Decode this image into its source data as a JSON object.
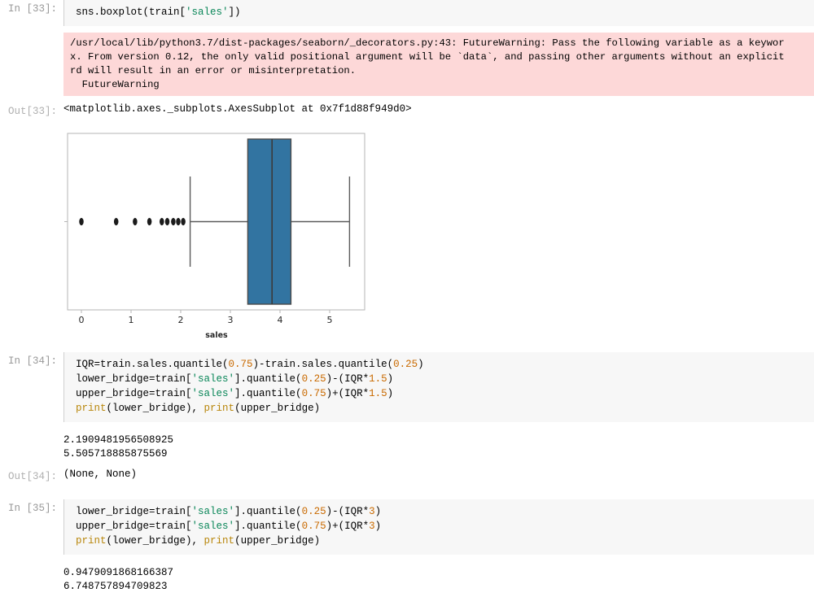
{
  "notebook": {
    "cells": [
      {
        "kind": "code",
        "prompt": "In [33]:",
        "source": "sns.boxplot(train['sales'])"
      },
      {
        "kind": "stderr",
        "text": "/usr/local/lib/python3.7/dist-packages/seaborn/_decorators.py:43: FutureWarning: Pass the following variable as a keyword\nx. From version 0.12, the only valid positional argument will be `data`, and passing other arguments without an explicit\nrd will result in an error or misinterpretation.\n  FutureWarning"
      },
      {
        "kind": "result",
        "prompt": "Out[33]:",
        "text": "<matplotlib.axes._subplots.AxesSubplot at 0x7f1d88f949d0>"
      },
      {
        "kind": "figure",
        "prompt": ""
      },
      {
        "kind": "code",
        "prompt": "In [34]:",
        "source": "IQR=train.sales.quantile(0.75)-train.sales.quantile(0.25)\nlower_bridge=train['sales'].quantile(0.25)-(IQR*1.5)\nupper_bridge=train['sales'].quantile(0.75)+(IQR*1.5)\nprint(lower_bridge), print(upper_bridge)"
      },
      {
        "kind": "stdout",
        "text": "2.1909481956508925\n5.505718885875569"
      },
      {
        "kind": "result",
        "prompt": "Out[34]:",
        "text": "(None, None)"
      },
      {
        "kind": "code",
        "prompt": "In [35]:",
        "source": "lower_bridge=train['sales'].quantile(0.25)-(IQR*3)\nupper_bridge=train['sales'].quantile(0.75)+(IQR*3)\nprint(lower_bridge), print(upper_bridge)"
      },
      {
        "kind": "stdout2",
        "text": "0.9479091868166387\n6.748757894709823"
      }
    ]
  },
  "cell33": {
    "prompt": "In [33]:",
    "code_pre": "sns.boxplot(train[",
    "code_str": "'sales'",
    "code_post": "])"
  },
  "warning": {
    "line1": "/usr/local/lib/python3.7/dist-packages/seaborn/_decorators.py:43: FutureWarning: Pass the following variable as a keywor",
    "line2": "x. From version 0.12, the only valid positional argument will be `data`, and passing other arguments without an explicit",
    "line3": "rd will result in an error or misinterpretation.",
    "line4": "  FutureWarning"
  },
  "out33": {
    "prompt": "Out[33]:",
    "text": "<matplotlib.axes._subplots.AxesSubplot at 0x7f1d88f949d0>"
  },
  "cell34": {
    "prompt": "In [34]:",
    "l1a": "IQR=train.sales.quantile(",
    "l1b": "0.75",
    "l1c": ")-train.sales.quantile(",
    "l1d": "0.25",
    "l1e": ")",
    "l2a": "lower_bridge=train[",
    "l2b": "'sales'",
    "l2c": "].quantile(",
    "l2d": "0.25",
    "l2e": ")-(IQR*",
    "l2f": "1.5",
    "l2g": ")",
    "l3a": "upper_bridge=train[",
    "l3b": "'sales'",
    "l3c": "].quantile(",
    "l3d": "0.75",
    "l3e": ")+(IQR*",
    "l3f": "1.5",
    "l3g": ")",
    "l4a": "print",
    "l4b": "(lower_bridge), ",
    "l4c": "print",
    "l4d": "(upper_bridge)"
  },
  "stdout34": {
    "line1": "2.1909481956508925",
    "line2": "5.505718885875569"
  },
  "out34": {
    "prompt": "Out[34]:",
    "text": "(None, None)"
  },
  "cell35": {
    "prompt": "In [35]:",
    "l1a": "lower_bridge=train[",
    "l1b": "'sales'",
    "l1c": "].quantile(",
    "l1d": "0.25",
    "l1e": ")-(IQR*",
    "l1f": "3",
    "l1g": ")",
    "l2a": "upper_bridge=train[",
    "l2b": "'sales'",
    "l2c": "].quantile(",
    "l2d": "0.75",
    "l2e": ")+(IQR*",
    "l2f": "3",
    "l2g": ")",
    "l3a": "print",
    "l3b": "(lower_bridge), ",
    "l3c": "print",
    "l3d": "(upper_bridge)"
  },
  "stdout35": {
    "line1": "0.9479091868166387",
    "line2": "6.748757894709823"
  },
  "chart_data": {
    "type": "box",
    "title": "",
    "xlabel": "sales",
    "ylabel": "",
    "xlim": [
      -0.33,
      5.72
    ],
    "xticks": [
      0,
      1,
      2,
      3,
      4,
      5
    ],
    "xticklabels": [
      "0",
      "1",
      "2",
      "3",
      "4",
      "5"
    ],
    "grid": false,
    "legend": null,
    "orientation": "horizontal",
    "box_fill_color": "#3274a1",
    "box_edge_color": "#4a4a4a",
    "flier_color": "#1b1b1b",
    "series": [
      {
        "name": "sales",
        "whisker_low": 2.19,
        "q1": 3.35,
        "median": 3.84,
        "q3": 4.22,
        "whisker_high": 5.4,
        "fliers": [
          0.0,
          0.7,
          1.08,
          1.37,
          1.62,
          1.73,
          1.85,
          1.95,
          2.05
        ]
      }
    ]
  },
  "colors": {
    "code_bg": "#f7f7f7",
    "warning_bg": "#fdd8d8",
    "prompt": "#999999",
    "box_blue": "#3274a1",
    "string_green": "#098658",
    "number_orange": "#c96a00",
    "function_gold": "#b8860b"
  }
}
